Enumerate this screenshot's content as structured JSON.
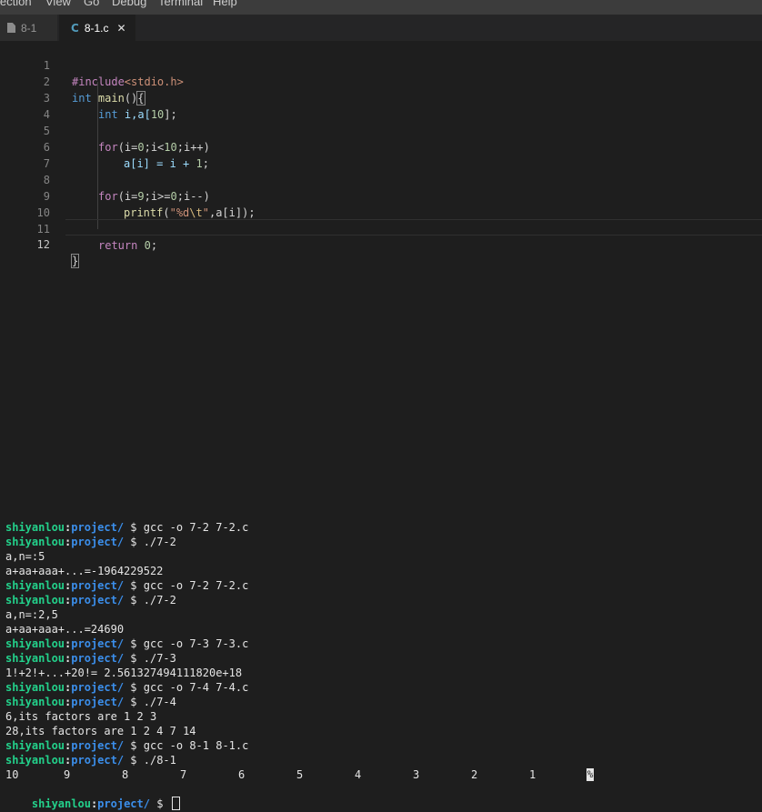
{
  "menu": [
    "lection",
    "View",
    "Go",
    "Debug",
    "Terminal",
    "Help"
  ],
  "tabs": [
    {
      "label": "8-1",
      "icon": "file-icon",
      "active": false
    },
    {
      "label": "8-1.c",
      "icon": "c-file-icon",
      "active": true
    }
  ],
  "editor": {
    "line_numbers": [
      "1",
      "2",
      "3",
      "4",
      "5",
      "6",
      "7",
      "8",
      "9",
      "10",
      "11",
      "12"
    ],
    "current_line": 12,
    "code": {
      "l1_directive": "#include",
      "l1_header": "<stdio.h>",
      "l2_type": "int",
      "l2_name": " main",
      "l2_paren": "()",
      "l2_brace": "{",
      "l3_type": "int",
      "l3_rest_a": " i,a[",
      "l3_num": "10",
      "l3_rest_b": "];",
      "l5_kw": "for",
      "l5_a": "(i=",
      "l5_n0": "0",
      "l5_b": ";i<",
      "l5_n1": "10",
      "l5_c": ";i++)",
      "l6_a": "a[i] = i + ",
      "l6_n": "1",
      "l6_b": ";",
      "l8_kw": "for",
      "l8_a": "(i=",
      "l8_n0": "9",
      "l8_b": ";i>=",
      "l8_n1": "0",
      "l8_c": ";i--)",
      "l9_fn": "printf",
      "l9_a": "(",
      "l9_s1": "\"%d",
      "l9_esc": "\\t",
      "l9_s2": "\"",
      "l9_b": ",a[i]);",
      "l11_kw": "return",
      "l11_sp": " ",
      "l11_n": "0",
      "l11_end": ";",
      "l12_brace": "}"
    }
  },
  "terminal": {
    "user": "shiyanlou",
    "dir": "project/",
    "prompt": " $ ",
    "lines": [
      {
        "type": "prompt",
        "cmd": "gcc -o 7-2 7-2.c"
      },
      {
        "type": "prompt",
        "cmd": "./7-2"
      },
      {
        "type": "output",
        "text": "a,n=:5"
      },
      {
        "type": "output",
        "text": "a+aa+aaa+...=-1964229522"
      },
      {
        "type": "prompt",
        "cmd": "gcc -o 7-2 7-2.c"
      },
      {
        "type": "prompt",
        "cmd": "./7-2"
      },
      {
        "type": "output",
        "text": "a,n=:2,5"
      },
      {
        "type": "output",
        "text": "a+aa+aaa+...=24690"
      },
      {
        "type": "prompt",
        "cmd": "gcc -o 7-3 7-3.c"
      },
      {
        "type": "prompt",
        "cmd": "./7-3"
      },
      {
        "type": "output",
        "text": "1!+2!+...+20!= 2.561327494111820e+18"
      },
      {
        "type": "prompt",
        "cmd": "gcc -o 7-4 7-4.c"
      },
      {
        "type": "prompt",
        "cmd": "./7-4"
      },
      {
        "type": "output",
        "text": "6,its factors are 1 2 3"
      },
      {
        "type": "output",
        "text": "28,its factors are 1 2 4 7 14"
      },
      {
        "type": "prompt",
        "cmd": "gcc -o 8-1 8-1.c"
      },
      {
        "type": "prompt",
        "cmd": "./8-1"
      }
    ],
    "program_output": [
      "10",
      "9",
      "8",
      "7",
      "6",
      "5",
      "4",
      "3",
      "2",
      "1"
    ],
    "eol_marker": "%",
    "final_prompt_cmd": ""
  }
}
